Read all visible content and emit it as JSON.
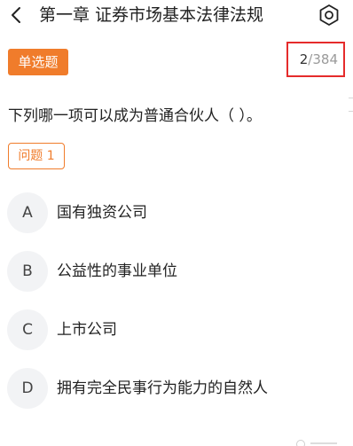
{
  "header": {
    "title": "第一章 证券市场基本法律法规",
    "back_icon": "chevron-left-icon",
    "settings_icon": "gear-icon"
  },
  "question_type": "单选题",
  "counter": {
    "current": "2",
    "separator": "/",
    "total": "384"
  },
  "question": {
    "text": "下列哪一项可以成为普通合伙人（ ）。",
    "tag": "问题 1"
  },
  "options": [
    {
      "letter": "A",
      "text": "国有独资公司"
    },
    {
      "letter": "B",
      "text": "公益性的事业单位"
    },
    {
      "letter": "C",
      "text": "上市公司"
    },
    {
      "letter": "D",
      "text": "拥有完全民事行为能力的自然人"
    }
  ],
  "colors": {
    "accent": "#f07c2b",
    "highlight_border": "#e52b2b",
    "option_circle": "#f2f3f5"
  }
}
